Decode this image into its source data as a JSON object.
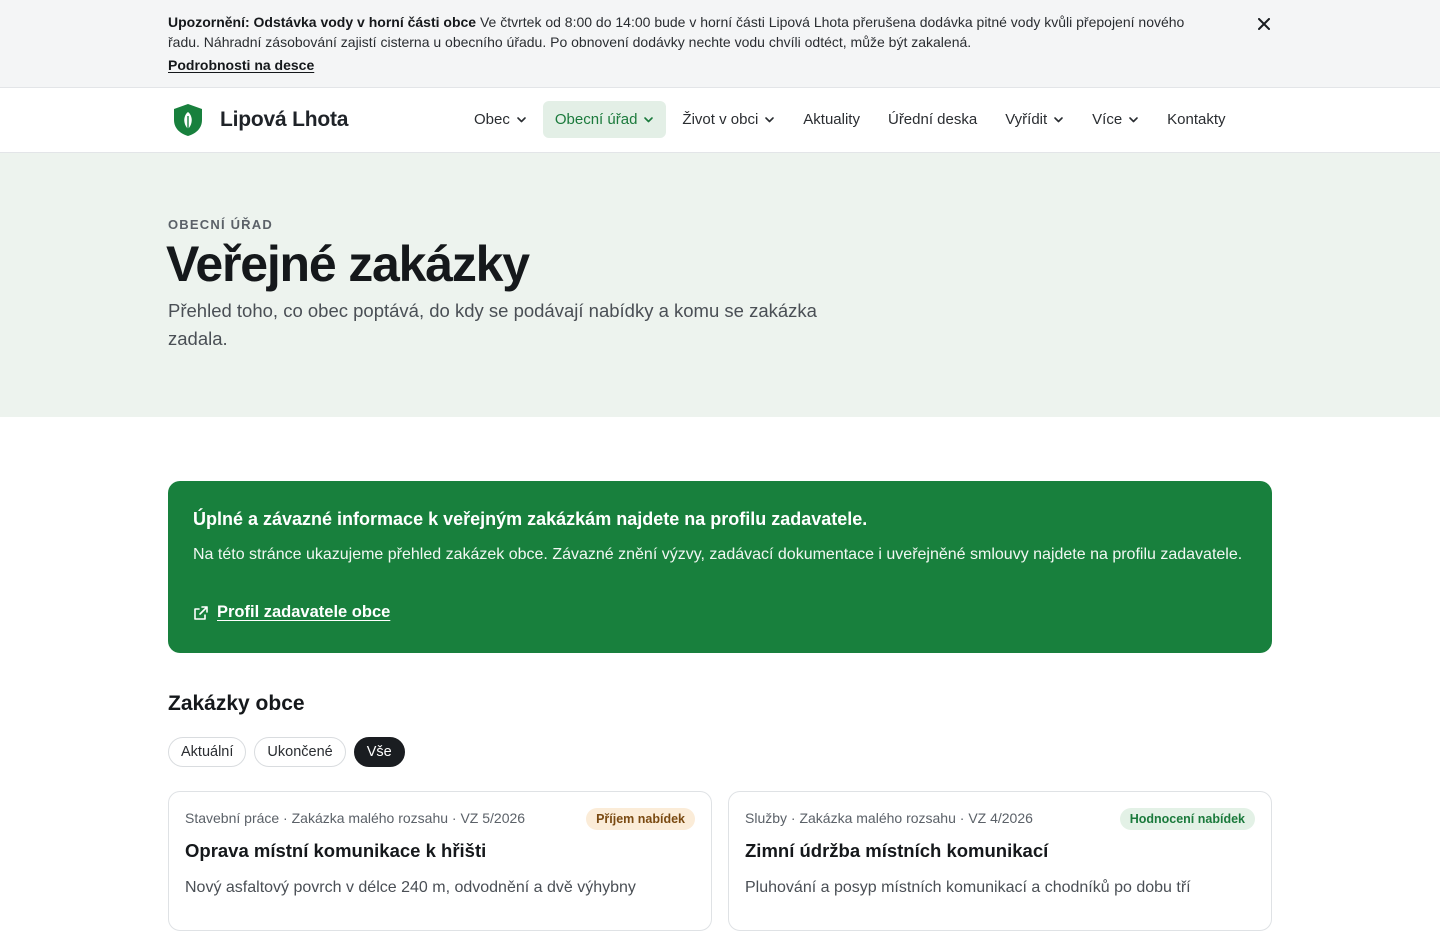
{
  "alert": {
    "title": "Upozornění: Odstávka vody v horní části obce",
    "text": "Ve čtvrtek od 8:00 do 14:00 bude v horní části Lipová Lhota přerušena dodávka pitné vody kvůli přepojení nového řadu. Náhradní zásobování zajistí cisterna u obecního úřadu. Po obnovení dodávky nechte vodu chvíli odtéct, může být zakalená.",
    "link": "Podrobnosti na desce",
    "close_icon": "close-icon"
  },
  "header": {
    "logo_text": "Lipová Lhota",
    "nav": [
      {
        "label": "Obec",
        "dropdown": true
      },
      {
        "label": "Obecní úřad",
        "dropdown": true,
        "active": true
      },
      {
        "label": "Život v obci",
        "dropdown": true
      },
      {
        "label": "Aktuality",
        "dropdown": false
      },
      {
        "label": "Úřední deska",
        "dropdown": false
      },
      {
        "label": "Vyřídit",
        "dropdown": true
      },
      {
        "label": "Více",
        "dropdown": true
      },
      {
        "label": "Kontakty",
        "dropdown": false
      }
    ]
  },
  "hero": {
    "eyebrow": "OBECNÍ ÚŘAD",
    "title": "Veřejné zakázky",
    "subtitle": "Přehled toho, co obec poptává, do kdy se podávají nabídky a komu se zakázka zadala."
  },
  "info": {
    "title": "Úplné a závazné informace k veřejným zakázkám najdete na profilu zadavatele.",
    "text": "Na této stránce ukazujeme přehled zakázek obce. Závazné znění výzvy, zadávací dokumentace i uveřejněné smlouvy najdete na profilu zadavatele.",
    "link": "Profil zadavatele obce"
  },
  "list": {
    "title": "Zakázky obce",
    "filters": [
      {
        "label": "Aktuální",
        "active": false
      },
      {
        "label": "Ukončené",
        "active": false
      },
      {
        "label": "Vše",
        "active": true
      }
    ],
    "cards": [
      {
        "meta": "Stavební práce · Zakázka malého rozsahu · VZ 5/2026",
        "badge": "Příjem nabídek",
        "title": "Oprava místní komunikace k hřišti",
        "desc": "Nový asfaltový povrch v délce 240 m, odvodnění a dvě výhybny"
      },
      {
        "meta": "Služby · Zakázka malého rozsahu · VZ 4/2026",
        "badge": "Hodnocení nabídek",
        "title": "Zimní údržba místních komunikací",
        "desc": "Pluhování a posyp místních komunikací a chodníků po dobu tří"
      }
    ]
  },
  "colors": {
    "brand_green": "#18803d",
    "hero_bg": "#edf3ee",
    "nav_active_bg": "#e3efe6"
  }
}
